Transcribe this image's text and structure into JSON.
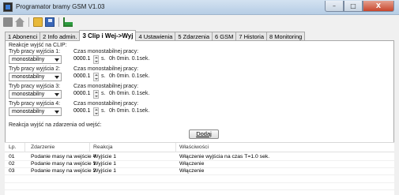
{
  "window": {
    "title": "Programator bramy GSM V1.03",
    "controls": {
      "minimize": "–",
      "maximize": "□",
      "close": "X"
    }
  },
  "toolbar": {
    "icons": [
      "stop-icon",
      "home-icon",
      "open-folder-icon",
      "save-icon",
      "chart-icon"
    ]
  },
  "tabs": [
    {
      "label": "1 Abonenci",
      "active": false
    },
    {
      "label": "2 Info admin.",
      "active": false
    },
    {
      "label": "3 Clip i Wej->Wyj",
      "active": true
    },
    {
      "label": "4 Ustawienia",
      "active": false
    },
    {
      "label": "5 Zdarzenia",
      "active": false
    },
    {
      "label": "6 GSM",
      "active": false
    },
    {
      "label": "7 Historia",
      "active": false
    },
    {
      "label": "8 Monitoring",
      "active": false
    }
  ],
  "clip": {
    "section_title": "Reakcje wyjść na CLIP:",
    "outputs": [
      {
        "mode_label": "Tryb pracy wyjścia 1:",
        "mode_value": "monostabilny",
        "time_label": "Czas monostabilnej pracy:",
        "time_value": "0000.1",
        "time_unit": "s.",
        "time_desc": "0h 0min. 0.1sek."
      },
      {
        "mode_label": "Tryb pracy wyjścia 2:",
        "mode_value": "monostabilny",
        "time_label": "Czas monostabilnej pracy:",
        "time_value": "0000.1",
        "time_unit": "s.",
        "time_desc": "0h 0min. 0.1sek."
      },
      {
        "mode_label": "Tryb pracy wyjścia 3:",
        "mode_value": "monostabilny",
        "time_label": "Czas monostabilnej pracy:",
        "time_value": "0000.1",
        "time_unit": "s.",
        "time_desc": "0h 0min. 0.1sek."
      },
      {
        "mode_label": "Tryb pracy wyjścia 4:",
        "mode_value": "monostabilny",
        "time_label": "Czas monostabilnej pracy:",
        "time_value": "0000.1",
        "time_unit": "s.",
        "time_desc": "0h 0min. 0.1sek."
      }
    ]
  },
  "reactions": {
    "section_title": "Reakcja wyjść na zdarzenia od wejść:",
    "add_button": "Dodaj",
    "columns": [
      "Lp.",
      "Zdarzenie",
      "Reakcja",
      "Właściwości"
    ],
    "rows": [
      [
        "01",
        "Podanie masy na wejście 4",
        "Wyjście 1",
        "Włączenie wyjścia na czas T=1.0 sek."
      ],
      [
        "02",
        "Podanie masy na wejście 1",
        "Wyjście 1",
        "Włączenie"
      ],
      [
        "03",
        "Podanie masy na wejście 2",
        "Wyjście 1",
        "Włączenie"
      ]
    ]
  }
}
